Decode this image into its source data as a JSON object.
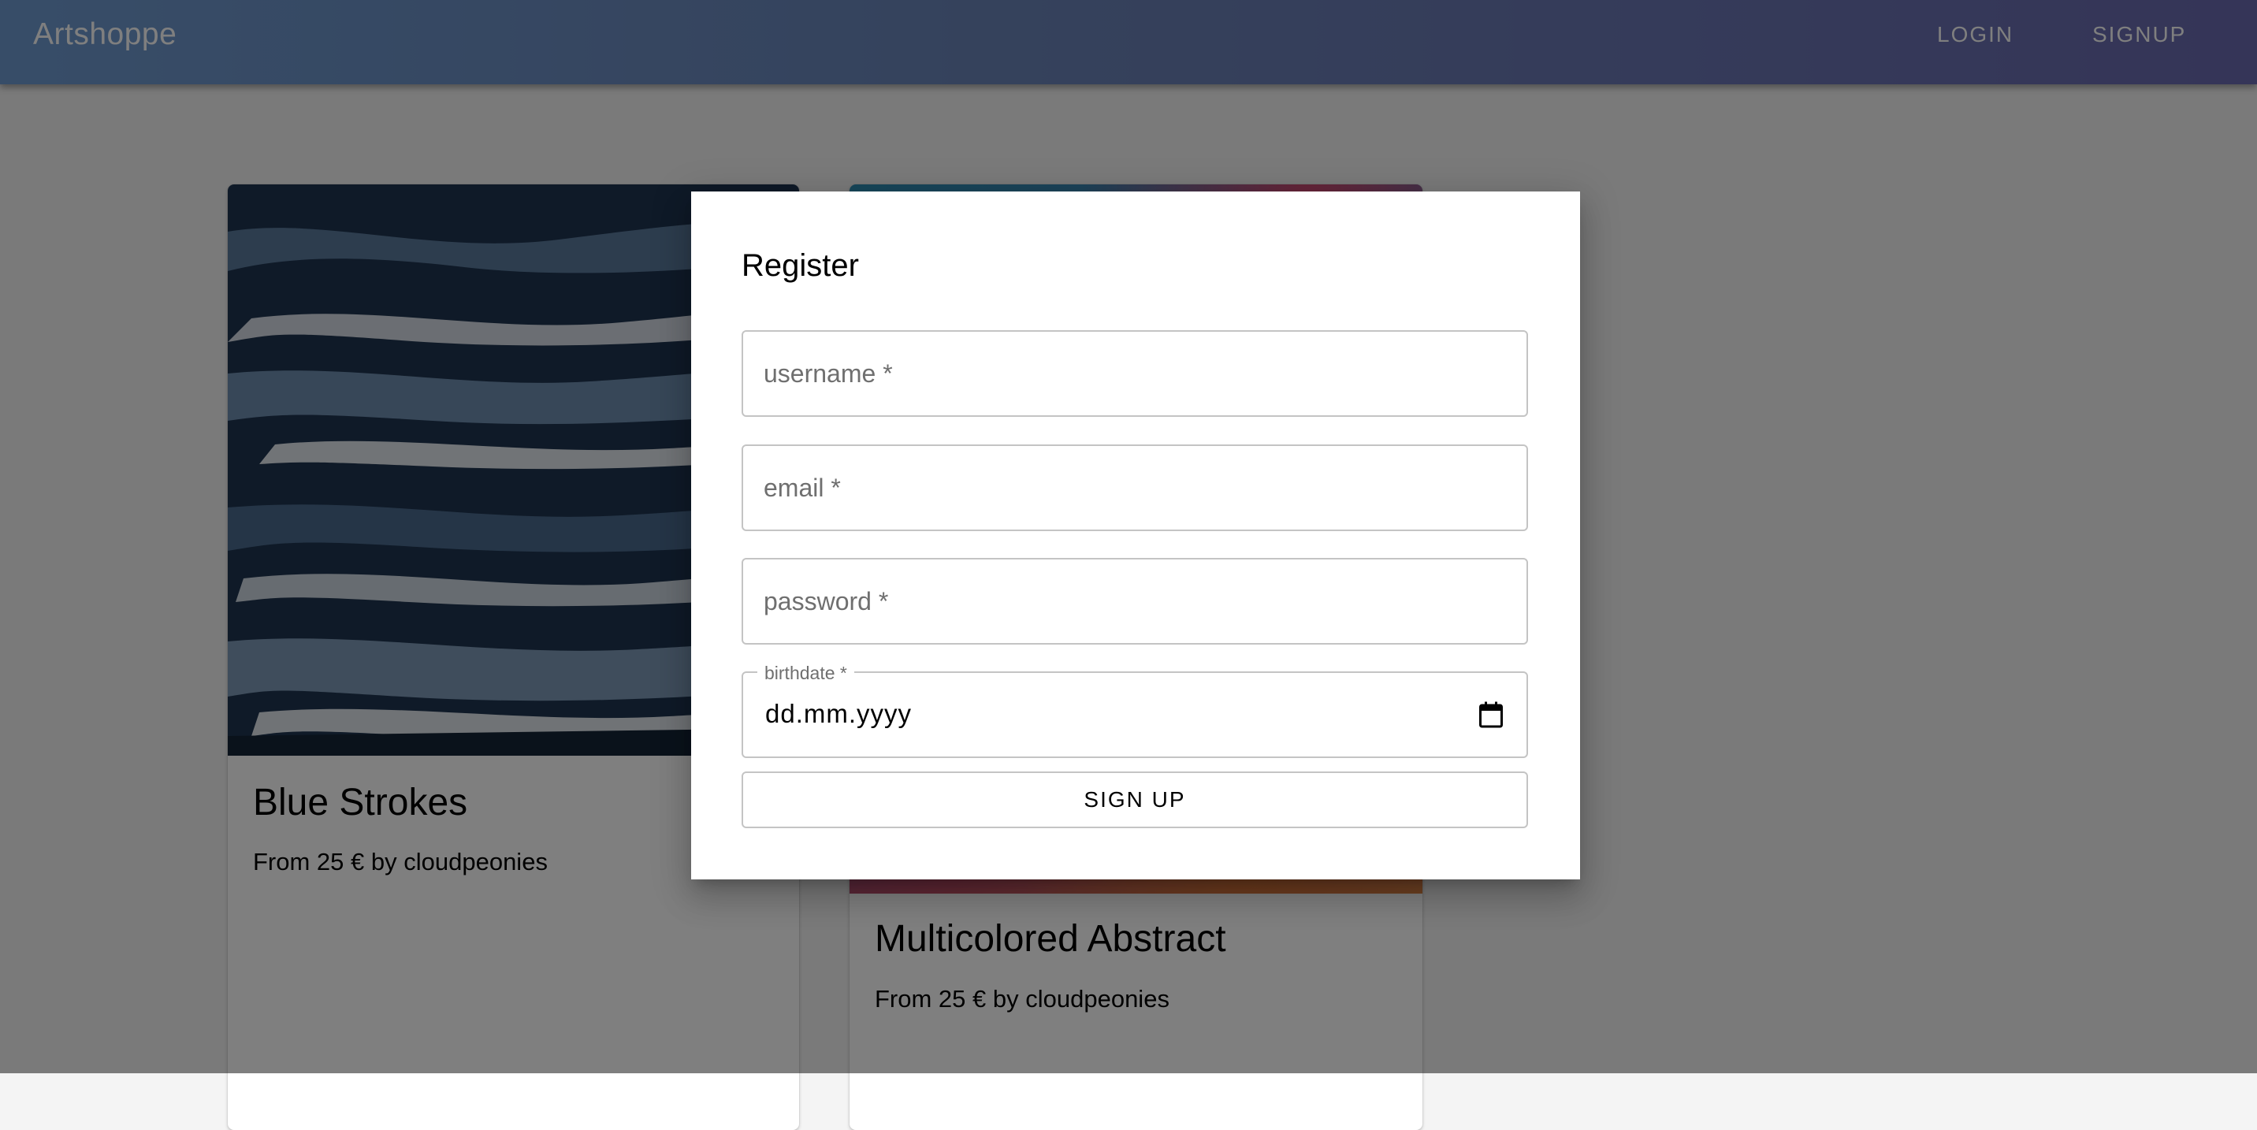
{
  "app": {
    "brand": "Artshoppe",
    "nav": {
      "login": "LOGIN",
      "signup": "SIGNUP"
    }
  },
  "products": [
    {
      "title": "Blue Strokes",
      "subtitle": "From 25 € by cloudpeonies"
    },
    {
      "title": "Multicolored Abstract",
      "subtitle": "From 25 € by cloudpeonies"
    }
  ],
  "dialog": {
    "title": "Register",
    "fields": {
      "username": {
        "placeholder": "username *"
      },
      "email": {
        "placeholder": "email *"
      },
      "password": {
        "placeholder": "password *"
      },
      "birthdate": {
        "label": "birthdate *",
        "value": "dd.mm.yyyy",
        "icon": "calendar-icon"
      }
    },
    "submit_label": "SIGN UP"
  },
  "colors": {
    "appbar_start": "#6f9bd1",
    "appbar_end": "#6a6ab0",
    "backdrop": "rgba(0,0,0,0.5)"
  }
}
